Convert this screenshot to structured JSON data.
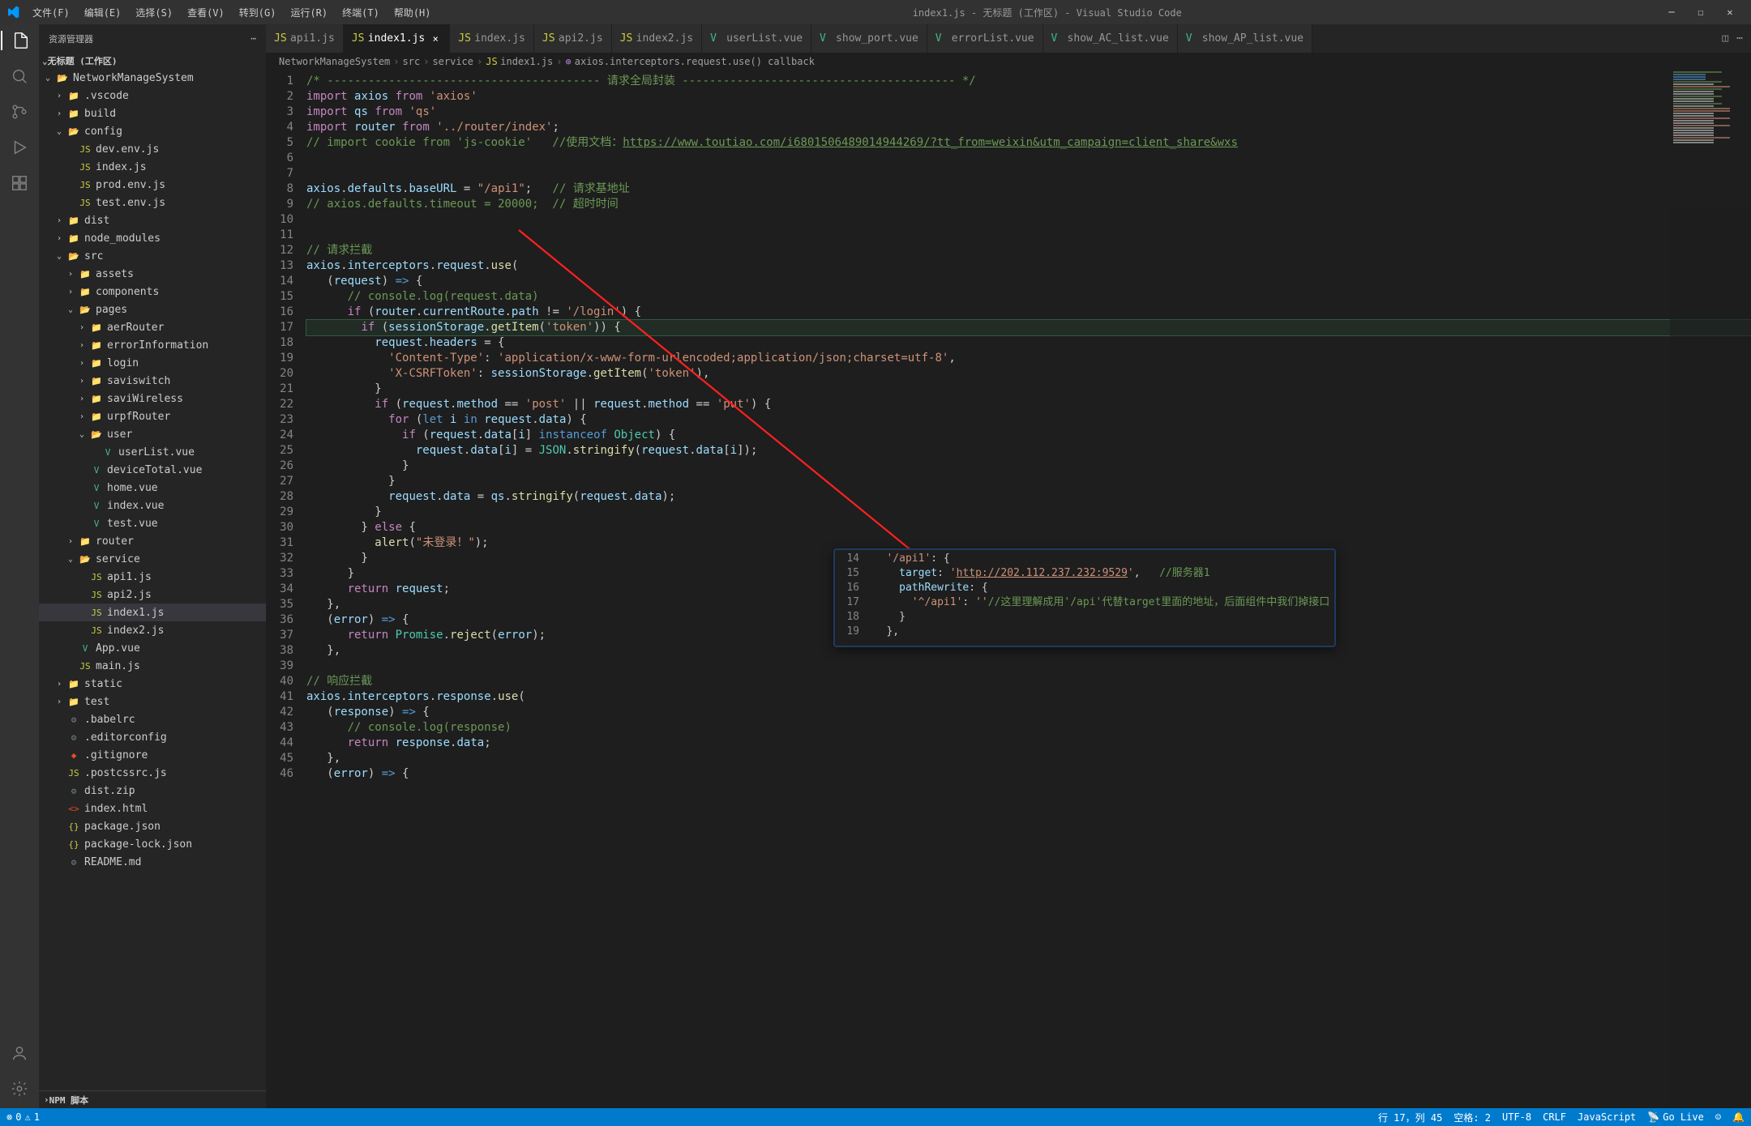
{
  "titlebar": {
    "menus": [
      "文件(F)",
      "编辑(E)",
      "选择(S)",
      "查看(V)",
      "转到(G)",
      "运行(R)",
      "终端(T)",
      "帮助(H)"
    ],
    "title": "index1.js - 无标题 (工作区) - Visual Studio Code"
  },
  "sidebar": {
    "header": "资源管理器",
    "workspace": "无标题 (工作区)",
    "tree": [
      {
        "d": 0,
        "t": "folder-open",
        "n": "NetworkManageSystem",
        "exp": true
      },
      {
        "d": 1,
        "t": "folder",
        "n": ".vscode"
      },
      {
        "d": 1,
        "t": "folder",
        "n": "build"
      },
      {
        "d": 1,
        "t": "folder-open",
        "n": "config",
        "exp": true
      },
      {
        "d": 2,
        "t": "js",
        "n": "dev.env.js"
      },
      {
        "d": 2,
        "t": "js",
        "n": "index.js"
      },
      {
        "d": 2,
        "t": "js",
        "n": "prod.env.js"
      },
      {
        "d": 2,
        "t": "js",
        "n": "test.env.js"
      },
      {
        "d": 1,
        "t": "folder",
        "n": "dist"
      },
      {
        "d": 1,
        "t": "folder",
        "n": "node_modules"
      },
      {
        "d": 1,
        "t": "folder-open",
        "n": "src",
        "exp": true
      },
      {
        "d": 2,
        "t": "folder",
        "n": "assets"
      },
      {
        "d": 2,
        "t": "folder",
        "n": "components"
      },
      {
        "d": 2,
        "t": "folder-open",
        "n": "pages",
        "exp": true
      },
      {
        "d": 3,
        "t": "folder",
        "n": "aerRouter"
      },
      {
        "d": 3,
        "t": "folder",
        "n": "errorInformation"
      },
      {
        "d": 3,
        "t": "folder",
        "n": "login"
      },
      {
        "d": 3,
        "t": "folder",
        "n": "saviswitch"
      },
      {
        "d": 3,
        "t": "folder",
        "n": "saviWireless"
      },
      {
        "d": 3,
        "t": "folder",
        "n": "urpfRouter"
      },
      {
        "d": 3,
        "t": "folder-open",
        "n": "user",
        "exp": true
      },
      {
        "d": 4,
        "t": "vue",
        "n": "userList.vue"
      },
      {
        "d": 3,
        "t": "vue",
        "n": "deviceTotal.vue"
      },
      {
        "d": 3,
        "t": "vue",
        "n": "home.vue"
      },
      {
        "d": 3,
        "t": "vue",
        "n": "index.vue"
      },
      {
        "d": 3,
        "t": "vue",
        "n": "test.vue"
      },
      {
        "d": 2,
        "t": "folder",
        "n": "router"
      },
      {
        "d": 2,
        "t": "folder-open",
        "n": "service",
        "exp": true
      },
      {
        "d": 3,
        "t": "js",
        "n": "api1.js"
      },
      {
        "d": 3,
        "t": "js",
        "n": "api2.js"
      },
      {
        "d": 3,
        "t": "js",
        "n": "index1.js",
        "sel": true
      },
      {
        "d": 3,
        "t": "js",
        "n": "index2.js"
      },
      {
        "d": 2,
        "t": "vue",
        "n": "App.vue"
      },
      {
        "d": 2,
        "t": "js",
        "n": "main.js"
      },
      {
        "d": 1,
        "t": "folder",
        "n": "static"
      },
      {
        "d": 1,
        "t": "folder",
        "n": "test"
      },
      {
        "d": 1,
        "t": "conf",
        "n": ".babelrc"
      },
      {
        "d": 1,
        "t": "conf",
        "n": ".editorconfig"
      },
      {
        "d": 1,
        "t": "git",
        "n": ".gitignore"
      },
      {
        "d": 1,
        "t": "js",
        "n": ".postcssrc.js"
      },
      {
        "d": 1,
        "t": "conf",
        "n": "dist.zip"
      },
      {
        "d": 1,
        "t": "html",
        "n": "index.html"
      },
      {
        "d": 1,
        "t": "json",
        "n": "package.json"
      },
      {
        "d": 1,
        "t": "json",
        "n": "package-lock.json"
      },
      {
        "d": 1,
        "t": "conf",
        "n": "README.md"
      }
    ],
    "npm": "NPM 脚本"
  },
  "tabs": [
    {
      "icon": "js",
      "label": "api1.js"
    },
    {
      "icon": "js",
      "label": "index1.js",
      "active": true
    },
    {
      "icon": "js",
      "label": "index.js"
    },
    {
      "icon": "js",
      "label": "api2.js"
    },
    {
      "icon": "js",
      "label": "index2.js"
    },
    {
      "icon": "vue",
      "label": "userList.vue"
    },
    {
      "icon": "vue",
      "label": "show_port.vue"
    },
    {
      "icon": "vue",
      "label": "errorList.vue"
    },
    {
      "icon": "vue",
      "label": "show_AC_list.vue"
    },
    {
      "icon": "vue",
      "label": "show_AP_list.vue"
    }
  ],
  "breadcrumb": [
    "NetworkManageSystem",
    "src",
    "service",
    "index1.js",
    "axios.interceptors.request.use() callback"
  ],
  "code": {
    "lines": [
      {
        "n": 1,
        "html": "<span class='cmt'>/* ---------------------------------------- 请求全局封装 ---------------------------------------- */</span>"
      },
      {
        "n": 2,
        "html": "<span class='kw2'>import</span> <span class='var'>axios</span> <span class='kw2'>from</span> <span class='str'>'axios'</span>"
      },
      {
        "n": 3,
        "html": "<span class='kw2'>import</span> <span class='var'>qs</span> <span class='kw2'>from</span> <span class='str'>'qs'</span>"
      },
      {
        "n": 4,
        "html": "<span class='kw2'>import</span> <span class='var'>router</span> <span class='kw2'>from</span> <span class='str'>'../router/index'</span>;"
      },
      {
        "n": 5,
        "html": "<span class='cmt'>// import cookie from 'js-cookie'   //使用文档：<span class='lnk'>https://www.toutiao.com/i6801506489014944269/?tt_from=weixin&utm_campaign=client_share&wxs</span></span>"
      },
      {
        "n": 6,
        "html": ""
      },
      {
        "n": 7,
        "html": ""
      },
      {
        "n": 8,
        "html": "<span class='var'>axios</span>.<span class='prop'>defaults</span>.<span class='prop'>baseURL</span> = <span class='str'>\"/api1\"</span>;   <span class='cmt'>// 请求基地址</span>"
      },
      {
        "n": 9,
        "html": "<span class='cmt'>// axios.defaults.timeout = 20000;  // 超时时间</span>"
      },
      {
        "n": 10,
        "html": ""
      },
      {
        "n": 11,
        "html": ""
      },
      {
        "n": 12,
        "html": "<span class='cmt'>// 请求拦截</span>"
      },
      {
        "n": 13,
        "html": "<span class='var'>axios</span>.<span class='prop'>interceptors</span>.<span class='prop'>request</span>.<span class='fn'>use</span>("
      },
      {
        "n": 14,
        "html": "   (<span class='var'>request</span>) <span class='kw'>=&gt;</span> {"
      },
      {
        "n": 15,
        "html": "      <span class='cmt'>// console.log(request.data)</span>"
      },
      {
        "n": 16,
        "html": "      <span class='kw2'>if</span> (<span class='var'>router</span>.<span class='prop'>currentRoute</span>.<span class='prop'>path</span> != <span class='str'>'/login'</span>) {"
      },
      {
        "n": 17,
        "hl": true,
        "html": "        <span class='kw2'>if</span> (<span class='var'>sessionStorage</span>.<span class='fn'>getItem</span>(<span class='str'>'token'</span>)) {"
      },
      {
        "n": 18,
        "html": "          <span class='var'>request</span>.<span class='prop'>headers</span> = {"
      },
      {
        "n": 19,
        "html": "            <span class='str'>'Content-Type'</span>: <span class='str'>'application/x-www-form-urlencoded;application/json;charset=utf-8'</span>,"
      },
      {
        "n": 20,
        "html": "            <span class='str'>'X-CSRFToken'</span>: <span class='var'>sessionStorage</span>.<span class='fn'>getItem</span>(<span class='str'>'token'</span>),"
      },
      {
        "n": 21,
        "html": "          }"
      },
      {
        "n": 22,
        "html": "          <span class='kw2'>if</span> (<span class='var'>request</span>.<span class='prop'>method</span> == <span class='str'>'post'</span> || <span class='var'>request</span>.<span class='prop'>method</span> == <span class='str'>'put'</span>) {"
      },
      {
        "n": 23,
        "html": "            <span class='kw2'>for</span> (<span class='kw'>let</span> <span class='var'>i</span> <span class='kw'>in</span> <span class='var'>request</span>.<span class='prop'>data</span>) {"
      },
      {
        "n": 24,
        "html": "              <span class='kw2'>if</span> (<span class='var'>request</span>.<span class='prop'>data</span>[<span class='var'>i</span>] <span class='kw'>instanceof</span> <span class='type'>Object</span>) {"
      },
      {
        "n": 25,
        "html": "                <span class='var'>request</span>.<span class='prop'>data</span>[<span class='var'>i</span>] = <span class='type'>JSON</span>.<span class='fn'>stringify</span>(<span class='var'>request</span>.<span class='prop'>data</span>[<span class='var'>i</span>]);"
      },
      {
        "n": 26,
        "html": "              }"
      },
      {
        "n": 27,
        "html": "            }"
      },
      {
        "n": 28,
        "html": "            <span class='var'>request</span>.<span class='prop'>data</span> = <span class='var'>qs</span>.<span class='fn'>stringify</span>(<span class='var'>request</span>.<span class='prop'>data</span>);"
      },
      {
        "n": 29,
        "html": "          }"
      },
      {
        "n": 30,
        "html": "        } <span class='kw2'>else</span> {"
      },
      {
        "n": 31,
        "html": "          <span class='fn'>alert</span>(<span class='str'>\"未登录！\"</span>);"
      },
      {
        "n": 32,
        "html": "        }"
      },
      {
        "n": 33,
        "html": "      }"
      },
      {
        "n": 34,
        "html": "      <span class='kw2'>return</span> <span class='var'>request</span>;"
      },
      {
        "n": 35,
        "html": "   },"
      },
      {
        "n": 36,
        "html": "   (<span class='var'>error</span>) <span class='kw'>=&gt;</span> {"
      },
      {
        "n": 37,
        "html": "      <span class='kw2'>return</span> <span class='type'>Promise</span>.<span class='fn'>reject</span>(<span class='var'>error</span>);"
      },
      {
        "n": 38,
        "html": "   },"
      },
      {
        "n": 39,
        "html": ""
      },
      {
        "n": 40,
        "html": "<span class='cmt'>// 响应拦截</span>"
      },
      {
        "n": 41,
        "html": "<span class='var'>axios</span>.<span class='prop'>interceptors</span>.<span class='prop'>response</span>.<span class='fn'>use</span>("
      },
      {
        "n": 42,
        "html": "   (<span class='var'>response</span>) <span class='kw'>=&gt;</span> {"
      },
      {
        "n": 43,
        "html": "      <span class='cmt'>// console.log(response)</span>"
      },
      {
        "n": 44,
        "html": "      <span class='kw2'>return</span> <span class='var'>response</span>.<span class='prop'>data</span>;"
      },
      {
        "n": 45,
        "html": "   },"
      },
      {
        "n": 46,
        "html": "   (<span class='var'>error</span>) <span class='kw'>=&gt;</span> {"
      }
    ]
  },
  "inset": {
    "lines": [
      {
        "n": 14,
        "html": "   <span class='str'>'/api1'</span>: {"
      },
      {
        "n": 15,
        "html": "     <span class='prop'>target</span>: <span class='str'>'<span class='lnk2'>http://202.112.237.232:9529</span>'</span>,   <span class='cmt'>//服务器1</span>"
      },
      {
        "n": 16,
        "html": "     <span class='prop'>pathRewrite</span>: {"
      },
      {
        "n": 17,
        "html": "       <span class='str'>'^/api1'</span>: <span class='str'>''</span><span class='cmt'>//这里理解成用'/api'代替target里面的地址，后面组件中我们掉接口</span>"
      },
      {
        "n": 18,
        "html": "     }"
      },
      {
        "n": 19,
        "html": "   },"
      }
    ]
  },
  "statusbar": {
    "errors": "0",
    "warnings": "1",
    "line": "行 17，列 45",
    "spaces": "空格: 2",
    "encoding": "UTF-8",
    "eol": "CRLF",
    "lang": "JavaScript",
    "golive": "Go Live"
  }
}
